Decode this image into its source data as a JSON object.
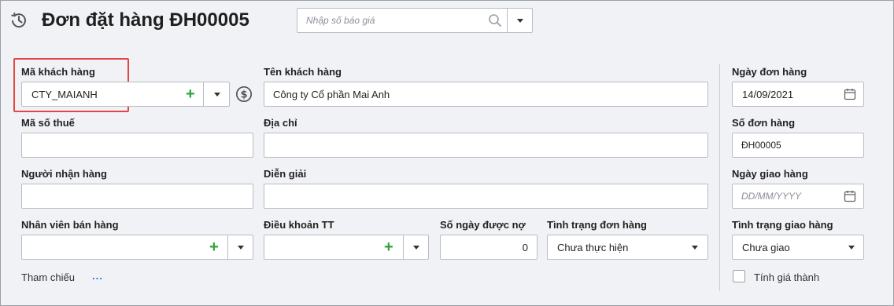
{
  "header": {
    "title": "Đơn đặt hàng ĐH00005",
    "quote_search_placeholder": "Nhập số báo giá"
  },
  "form": {
    "customer_code": {
      "label": "Mã khách hàng",
      "value": "CTY_MAIANH"
    },
    "customer_name": {
      "label": "Tên khách hàng",
      "value": "Công ty Cổ phần Mai Anh"
    },
    "tax_code": {
      "label": "Mã số thuế",
      "value": ""
    },
    "address": {
      "label": "Địa chỉ",
      "value": ""
    },
    "recipient": {
      "label": "Người nhận hàng",
      "value": ""
    },
    "description": {
      "label": "Diễn giải",
      "value": ""
    },
    "salesperson": {
      "label": "Nhân viên bán hàng",
      "value": ""
    },
    "payment_terms": {
      "label": "Điều khoản TT",
      "value": ""
    },
    "credit_days": {
      "label": "Số ngày được nợ",
      "value": "0"
    },
    "order_status": {
      "label": "Tình trạng đơn hàng",
      "value": "Chưa thực hiện"
    },
    "reference": {
      "label": "Tham chiếu",
      "link": "..."
    }
  },
  "side": {
    "order_date": {
      "label": "Ngày đơn hàng",
      "value": "14/09/2021"
    },
    "order_number": {
      "label": "Số đơn hàng",
      "value": "ĐH00005"
    },
    "delivery_date": {
      "label": "Ngày giao hàng",
      "placeholder": "DD/MM/YYYY"
    },
    "delivery_status": {
      "label": "Tình trạng giao hàng",
      "value": "Chưa giao"
    },
    "calc_cost": {
      "label": "Tính giá thành",
      "checked": false
    }
  },
  "colors": {
    "accent_plus": "#2fa33a",
    "highlight_box": "#e04848",
    "link": "#1a73e8",
    "background": "#f1f2f6"
  }
}
